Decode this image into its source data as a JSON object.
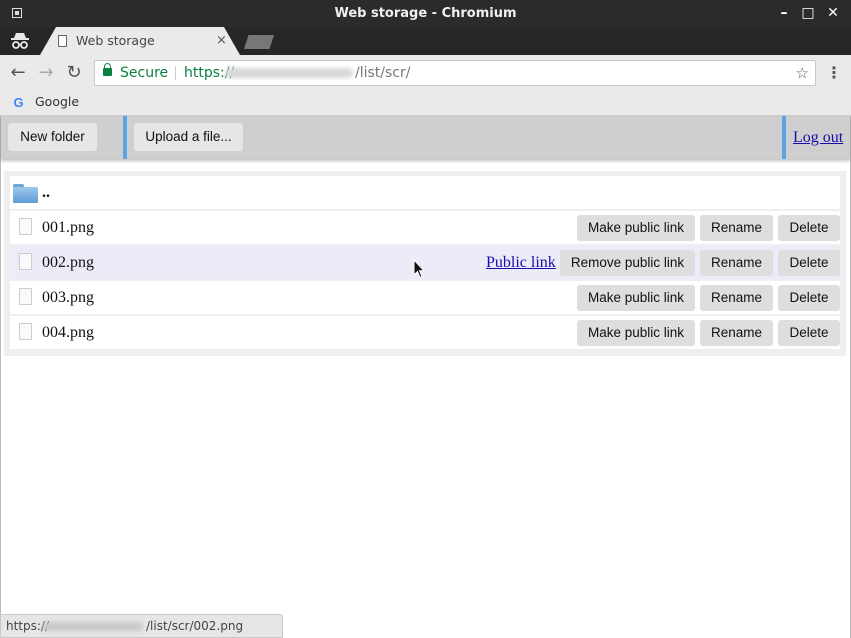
{
  "window": {
    "title": "Web storage - Chromium",
    "controls": [
      "–",
      "□",
      "✕"
    ]
  },
  "tab": {
    "title": "Web storage",
    "close": "×"
  },
  "toolbar": {
    "back": "←",
    "forward": "→",
    "reload": "↻",
    "secure_label": "Secure",
    "url_scheme": "https://",
    "url_path": "/list/scr/",
    "star": "☆",
    "menu": "⋮"
  },
  "bookmarks": {
    "google_letter": "G",
    "google_label": "Google"
  },
  "app": {
    "new_folder": "New folder",
    "upload": "Upload a file...",
    "logout": "Log out",
    "parent_dir": "..",
    "files": [
      {
        "name": "001.png",
        "public_link": null,
        "link_button": "Make public link",
        "rename": "Rename",
        "delete": "Delete"
      },
      {
        "name": "002.png",
        "public_link": "Public link",
        "link_button": "Remove public link",
        "rename": "Rename",
        "delete": "Delete",
        "highlighted": true
      },
      {
        "name": "003.png",
        "public_link": null,
        "link_button": "Make public link",
        "rename": "Rename",
        "delete": "Delete"
      },
      {
        "name": "004.png",
        "public_link": null,
        "link_button": "Make public link",
        "rename": "Rename",
        "delete": "Delete"
      }
    ]
  },
  "statusbar": {
    "prefix": "https://",
    "suffix": "/list/scr/002.png"
  },
  "colors": {
    "separator": "#5aa5e8",
    "link": "#1a0dab",
    "secure": "#0b8043",
    "row_highlight": "#ececf9"
  }
}
